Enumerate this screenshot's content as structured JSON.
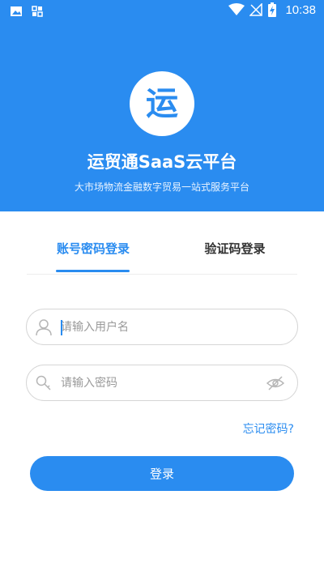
{
  "status_bar": {
    "time": "10:38",
    "icons": [
      "image-icon",
      "app-grid-icon",
      "wifi-icon",
      "no-signal-icon",
      "battery-charging-icon"
    ]
  },
  "brand": {
    "logo_glyph": "运",
    "title": "运贸通SaaS云平台",
    "subtitle": "大市场物流金融数字贸易一站式服务平台"
  },
  "tabs": [
    {
      "label": "账号密码登录",
      "active": true
    },
    {
      "label": "验证码登录",
      "active": false
    }
  ],
  "form": {
    "username": {
      "placeholder": "请输入用户名",
      "value": "",
      "icon": "user-icon"
    },
    "password": {
      "placeholder": "请输入密码",
      "value": "",
      "icon": "key-icon",
      "toggle_icon": "eye-hidden-icon"
    },
    "forgot_label": "忘记密码?",
    "submit_label": "登录"
  },
  "colors": {
    "primary": "#2a8cf0",
    "white": "#ffffff",
    "border": "#d6d6d6",
    "placeholder": "#9a9a9a"
  }
}
